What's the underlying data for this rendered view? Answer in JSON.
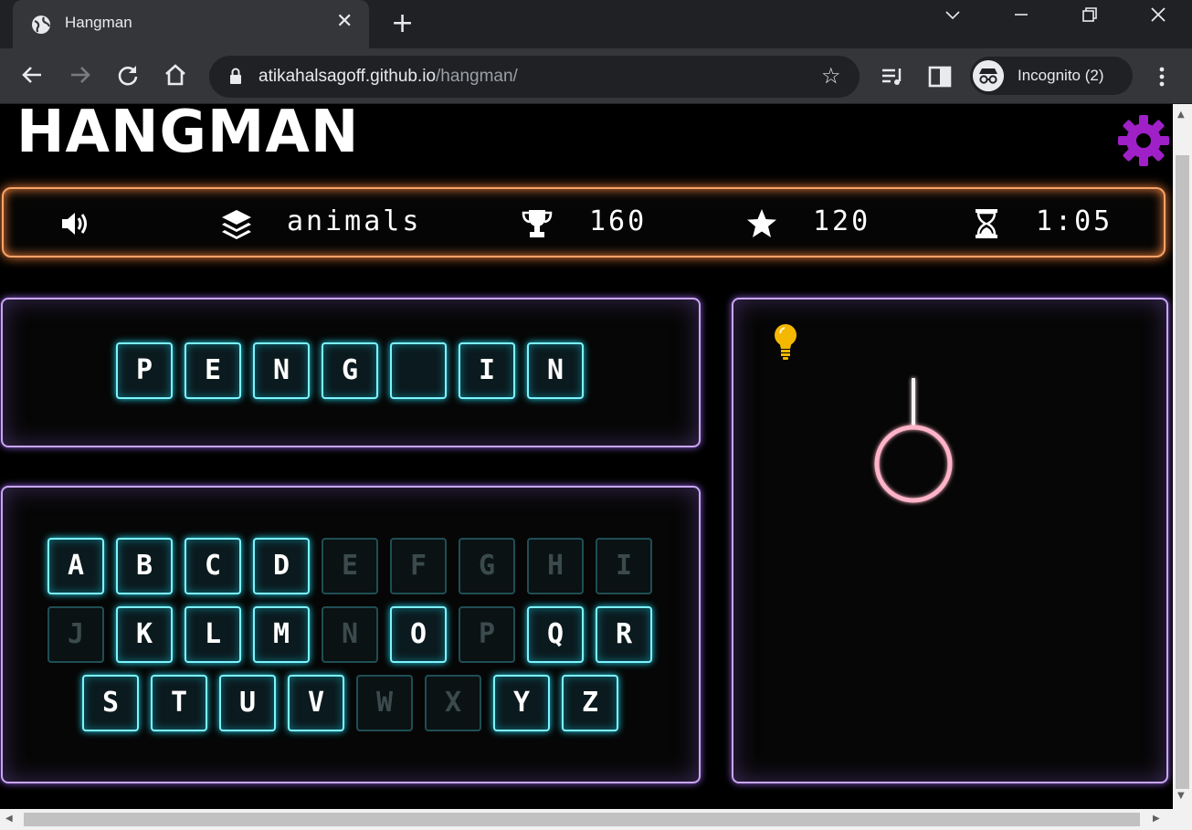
{
  "browser": {
    "tab_title": "Hangman",
    "tab_close": "✕",
    "new_tab": "+",
    "url_host": "atikahalsagoff.github.io",
    "url_path": "/hangman/",
    "profile_label": "Incognito (2)"
  },
  "game": {
    "title": "HANGMAN",
    "category": "animals",
    "high_score": "160",
    "score": "120",
    "timer": "1:05",
    "word_tiles": [
      "P",
      "E",
      "N",
      "G",
      "",
      "I",
      "N"
    ],
    "keyboard": [
      [
        {
          "letter": "A",
          "used": false
        },
        {
          "letter": "B",
          "used": false
        },
        {
          "letter": "C",
          "used": false
        },
        {
          "letter": "D",
          "used": false
        },
        {
          "letter": "E",
          "used": true
        },
        {
          "letter": "F",
          "used": true
        },
        {
          "letter": "G",
          "used": true
        },
        {
          "letter": "H",
          "used": true
        },
        {
          "letter": "I",
          "used": true
        }
      ],
      [
        {
          "letter": "J",
          "used": true
        },
        {
          "letter": "K",
          "used": false
        },
        {
          "letter": "L",
          "used": false
        },
        {
          "letter": "M",
          "used": false
        },
        {
          "letter": "N",
          "used": true
        },
        {
          "letter": "O",
          "used": false
        },
        {
          "letter": "P",
          "used": true
        },
        {
          "letter": "Q",
          "used": false
        },
        {
          "letter": "R",
          "used": false
        }
      ],
      [
        {
          "letter": "S",
          "used": false
        },
        {
          "letter": "T",
          "used": false
        },
        {
          "letter": "U",
          "used": false
        },
        {
          "letter": "V",
          "used": false
        },
        {
          "letter": "W",
          "used": true
        },
        {
          "letter": "X",
          "used": true
        },
        {
          "letter": "Y",
          "used": false
        },
        {
          "letter": "Z",
          "used": false
        }
      ]
    ],
    "hangman_stage": "head"
  },
  "icons": {
    "sound": "speaker-icon",
    "category": "layers-icon",
    "high_score": "trophy-icon",
    "score": "star-icon",
    "timer": "hourglass-icon",
    "settings": "gear-icon",
    "hint": "lightbulb-icon"
  },
  "colors": {
    "status_border": "#f7a46a",
    "panel_border": "#c9a6f5",
    "tile_border": "#7ef3ff",
    "settings_gear": "#a020c8",
    "hint_bulb": "#f5b800",
    "gallows_pink": "#ff5fa2"
  }
}
